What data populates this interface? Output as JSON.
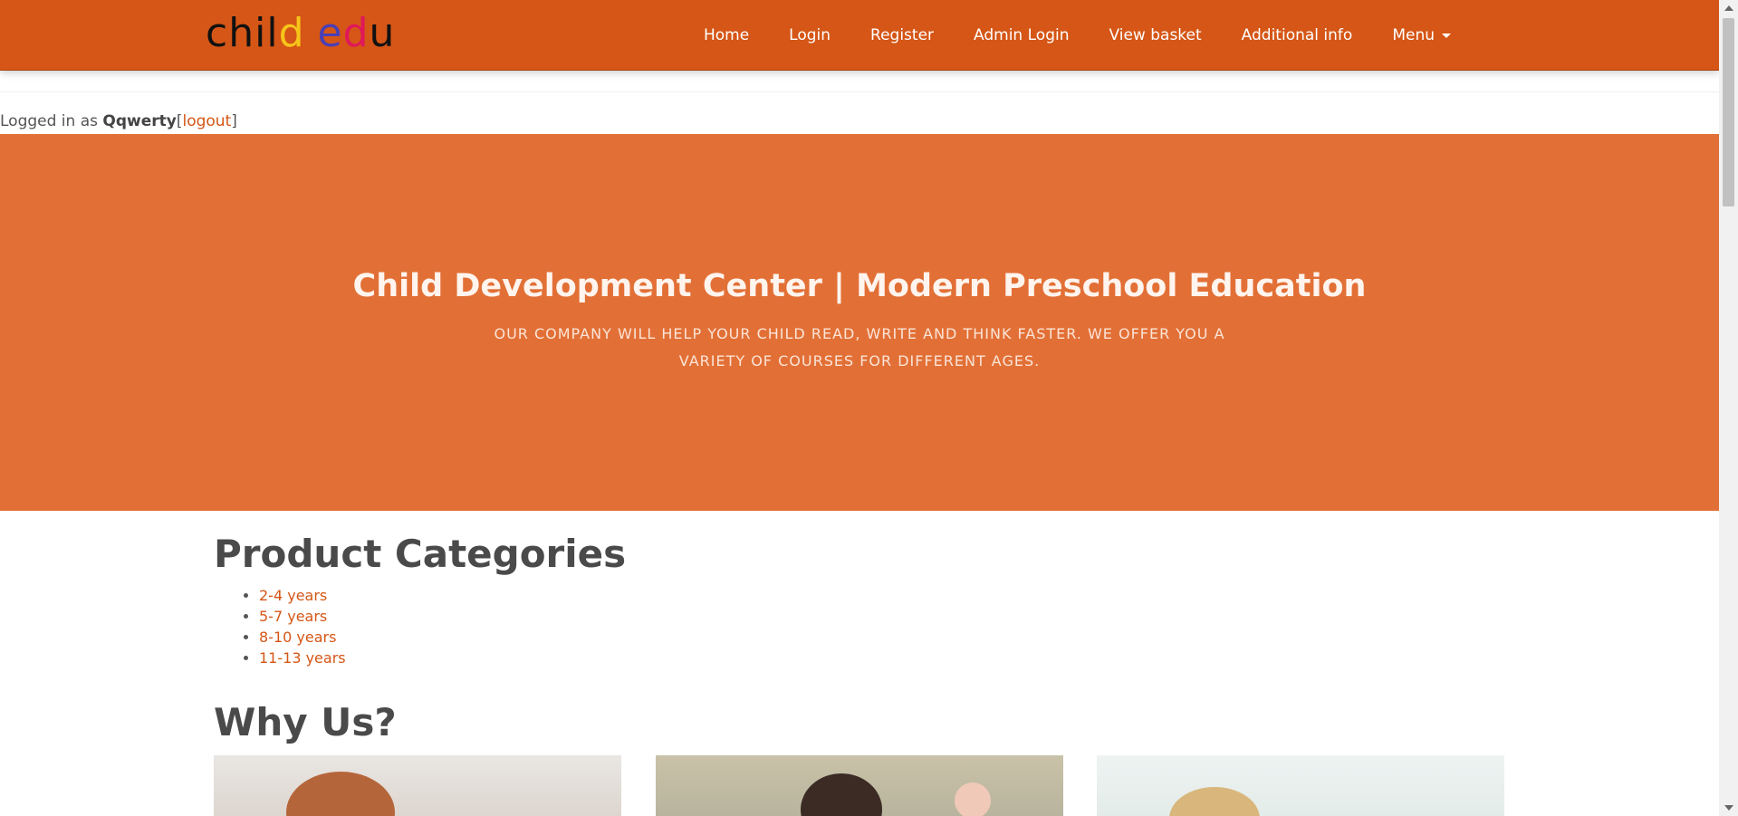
{
  "brand": {
    "letters": [
      "c",
      "h",
      "i",
      "l",
      "d",
      " ",
      "e",
      "d",
      "u"
    ],
    "letter_colors": [
      "#111111",
      "#111111",
      "#111111",
      "#111111",
      "#f7c51a",
      "#111111",
      "#4a3fb5",
      "#e0185a",
      "#111111"
    ]
  },
  "nav": {
    "items": [
      {
        "label": "Home"
      },
      {
        "label": "Login"
      },
      {
        "label": "Register"
      },
      {
        "label": "Admin Login"
      },
      {
        "label": "View basket"
      },
      {
        "label": "Additional info"
      },
      {
        "label": "Menu"
      }
    ]
  },
  "session": {
    "prefix": "Logged in as ",
    "username": "Qqwerty",
    "open_bracket": "[",
    "logout_label": "logout",
    "close_bracket": "]"
  },
  "hero": {
    "title": "Child Development Center | Modern Preschool Education",
    "subtitle": "OUR COMPANY WILL HELP YOUR CHILD READ, WRITE AND THINK FASTER. WE OFFER YOU A VARIETY OF COURSES FOR DIFFERENT AGES."
  },
  "categories": {
    "heading": "Product Categories",
    "items": [
      {
        "label": "2-4 years"
      },
      {
        "label": "5-7 years"
      },
      {
        "label": "8-10 years"
      },
      {
        "label": "11-13 years"
      }
    ]
  },
  "why_us": {
    "heading": "Why Us?"
  },
  "colors": {
    "navbar": "#d55616",
    "hero": "#e27036",
    "link": "#d55616"
  }
}
